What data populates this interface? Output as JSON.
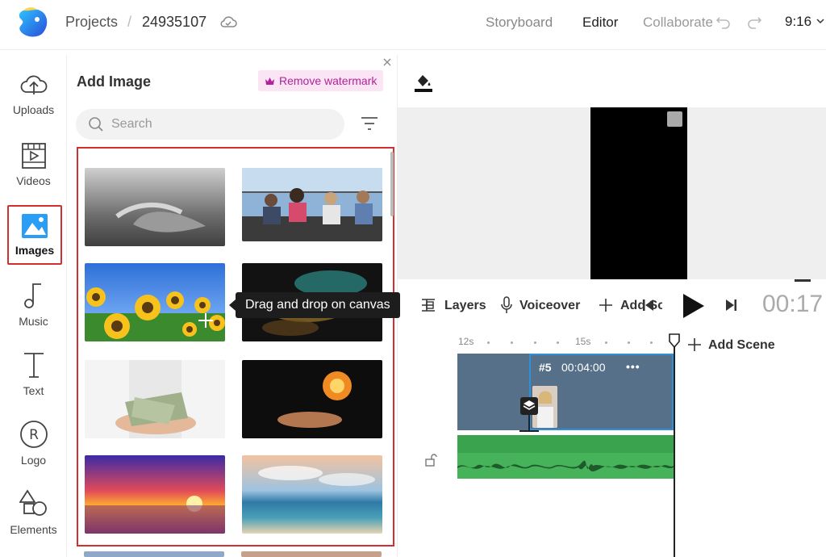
{
  "header": {
    "breadcrumb_root": "Projects",
    "breadcrumb_sep": "/",
    "project_id": "24935107",
    "nav": {
      "storyboard": "Storyboard",
      "editor": "Editor",
      "collaborate": "Collaborate"
    },
    "aspect_ratio": "9:16"
  },
  "sidebar": {
    "items": [
      {
        "label": "Uploads",
        "icon": "upload-cloud-icon"
      },
      {
        "label": "Videos",
        "icon": "video-icon"
      },
      {
        "label": "Images",
        "icon": "image-icon",
        "active": true
      },
      {
        "label": "Music",
        "icon": "music-note-icon"
      },
      {
        "label": "Text",
        "icon": "text-icon"
      },
      {
        "label": "Logo",
        "icon": "registered-logo-icon"
      },
      {
        "label": "Elements",
        "icon": "shapes-icon"
      }
    ]
  },
  "panel": {
    "title": "Add Image",
    "remove_watermark": "Remove watermark",
    "search_placeholder": "Search",
    "tooltip": "Drag and drop on canvas"
  },
  "toolbar": {
    "layers": "Layers",
    "voiceover": "Voiceover",
    "add_scene": "Add Scene",
    "time": "00:17"
  },
  "timeline": {
    "tick_12": "12s",
    "tick_15": "15s",
    "add_scene": "Add Scene",
    "scene_number": "#5",
    "scene_duration": "00:04:00",
    "scene_more": "•••"
  },
  "colors": {
    "accent_red": "#d23030",
    "scene_block": "#557088",
    "scene_selected_border": "#2f8fd8",
    "audio_track": "#46b35a",
    "watermark_bg": "#fbe4f4",
    "watermark_text": "#b0239a"
  }
}
